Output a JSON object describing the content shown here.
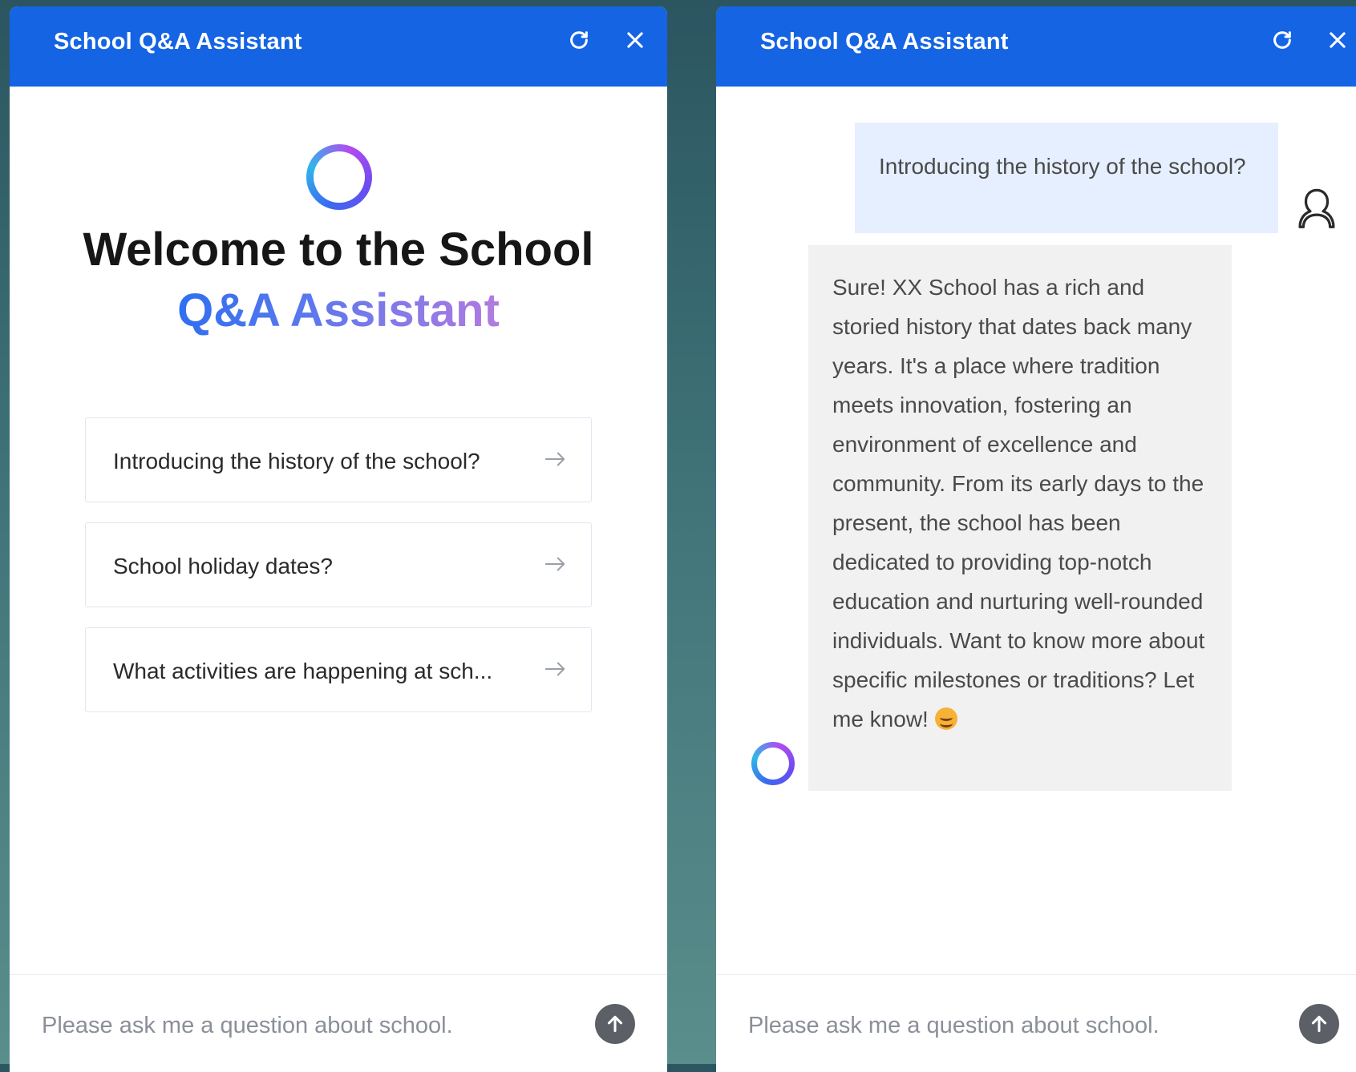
{
  "left_panel": {
    "header": {
      "title": "School Q&A Assistant",
      "refresh_icon": "refresh-icon",
      "close_icon": "close-icon"
    },
    "welcome": {
      "line1": "Welcome to the School",
      "line2": "Q&A Assistant"
    },
    "suggestions": [
      {
        "label": "Introducing the history of the school?",
        "icon": "arrow-right-icon"
      },
      {
        "label": "School holiday dates?",
        "icon": "arrow-right-icon"
      },
      {
        "label": "What activities are happening at sch...",
        "icon": "arrow-right-icon"
      }
    ],
    "input": {
      "placeholder": "Please ask me a question about school.",
      "value": ""
    },
    "send_icon": "arrow-up-icon"
  },
  "right_panel": {
    "header": {
      "title": "School Q&A Assistant",
      "refresh_icon": "refresh-icon",
      "close_icon": "close-icon"
    },
    "messages": [
      {
        "role": "user",
        "text": "Introducing the history of the school?"
      },
      {
        "role": "assistant",
        "text": "Sure! XX School has a rich and storied history that dates back many years. It's a place where tradition meets innovation, fostering an environment of excellence and community. From its early days to the present, the school has been dedicated to providing top-notch education and nurturing well-rounded individuals. Want to know more about specific milestones or traditions? Let me know!",
        "emoji": "smiling-face-emoji"
      }
    ],
    "input": {
      "placeholder": "Please ask me a question about school.",
      "value": ""
    },
    "send_icon": "arrow-up-icon"
  },
  "colors": {
    "header_blue": "#1464e4",
    "user_bubble": "#e6efff",
    "bot_bubble": "#f1f1f1",
    "send_button": "#5c6066"
  }
}
